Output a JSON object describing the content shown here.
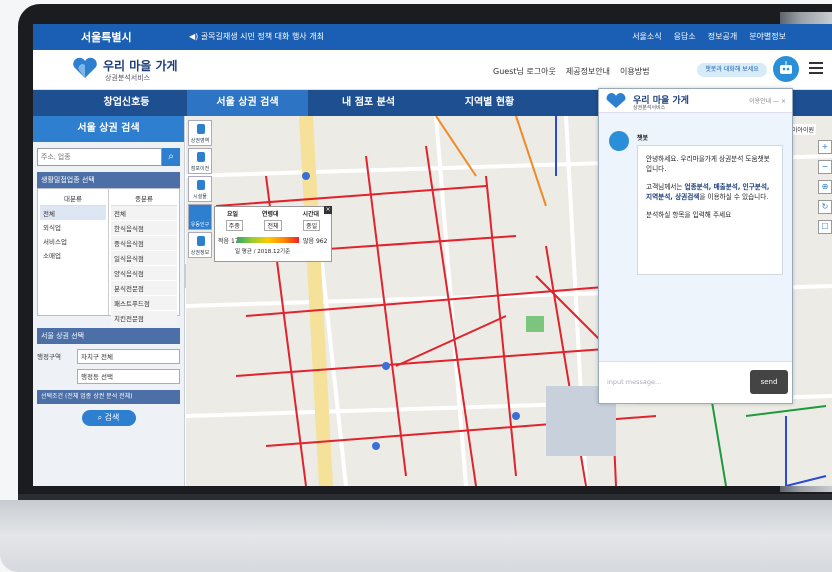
{
  "topbar": {
    "logo": "서울특별시",
    "notice": "◀) 골목길재생 시민 정책 대화 행사 개최",
    "links": [
      "서울소식",
      "응답소",
      "정보공개",
      "분야별정보"
    ]
  },
  "brand": {
    "name": "우리 마을 가게",
    "sub": "상권분석서비스",
    "guest": "Guest님 로그아웃",
    "info": "제공정보안내",
    "howto": "이용방법",
    "chat_button": "챗봇과 대화해 보세요"
  },
  "nav": [
    "창업신호등",
    "서울 상권 검색",
    "내 점포 분석",
    "지역별 현황",
    ""
  ],
  "left": {
    "title": "서울 상권 검색",
    "search_placeholder": "주소, 업종",
    "category_head": "생활밀접업종 선택",
    "major_head": "대분류",
    "minor_head": "중분류",
    "major": [
      "전체",
      "외식업",
      "서비스업",
      "소매업"
    ],
    "minor": [
      "전체",
      "한식음식점",
      "중식음식점",
      "일식음식점",
      "양식음식점",
      "분식전문점",
      "패스트푸드점",
      "치킨전문점",
      "제과점"
    ],
    "select_head": "서울 상권 선택",
    "district_label": "행정구역",
    "district_value": "자치구 전체",
    "dong_value": "행정동 선택",
    "condition": "선택조건 (전체 업종 상권 분석 전체)",
    "search_button": "검색"
  },
  "map": {
    "tools": [
      "상권영역",
      "점포이전",
      "시설물",
      "유동인구",
      "상권정보"
    ],
    "legend": {
      "day": "요일",
      "age": "연령대",
      "time": "시간대",
      "day_val": "주중",
      "age_val": "전체",
      "time_val": "중일",
      "low_label": "적음",
      "low_num": "17",
      "high_label": "많음",
      "high_num": "962",
      "note": "일 평균 / 2018.12기준",
      "close": "×"
    },
    "right_tag": "초이아이원",
    "right_tools": [
      "+",
      "−",
      "⊕",
      "↻",
      "☐"
    ]
  },
  "chat": {
    "title": "우리 마을 가게",
    "sub": "상권분석서비스",
    "controls": "이용안내 — ×",
    "bot_name": "챗봇",
    "msg1": "안녕하세요. 우리마을가게 상권분석 도움챗봇 입니다.",
    "msg2a": "고객님께서는 ",
    "msg2b": "업종분석, 매출분석, 인구분석, 지역분석, 상권검색",
    "msg2c": "을 이용하실 수 있습니다.",
    "msg3": "분석하실 항목을 입력해 주세요",
    "placeholder": "input message...",
    "send": "send"
  },
  "colors": {
    "topbar": "#1a5fb4",
    "nav": "#1d4f91",
    "nav_active": "#2d74c4",
    "accent": "#2f7fd0"
  }
}
